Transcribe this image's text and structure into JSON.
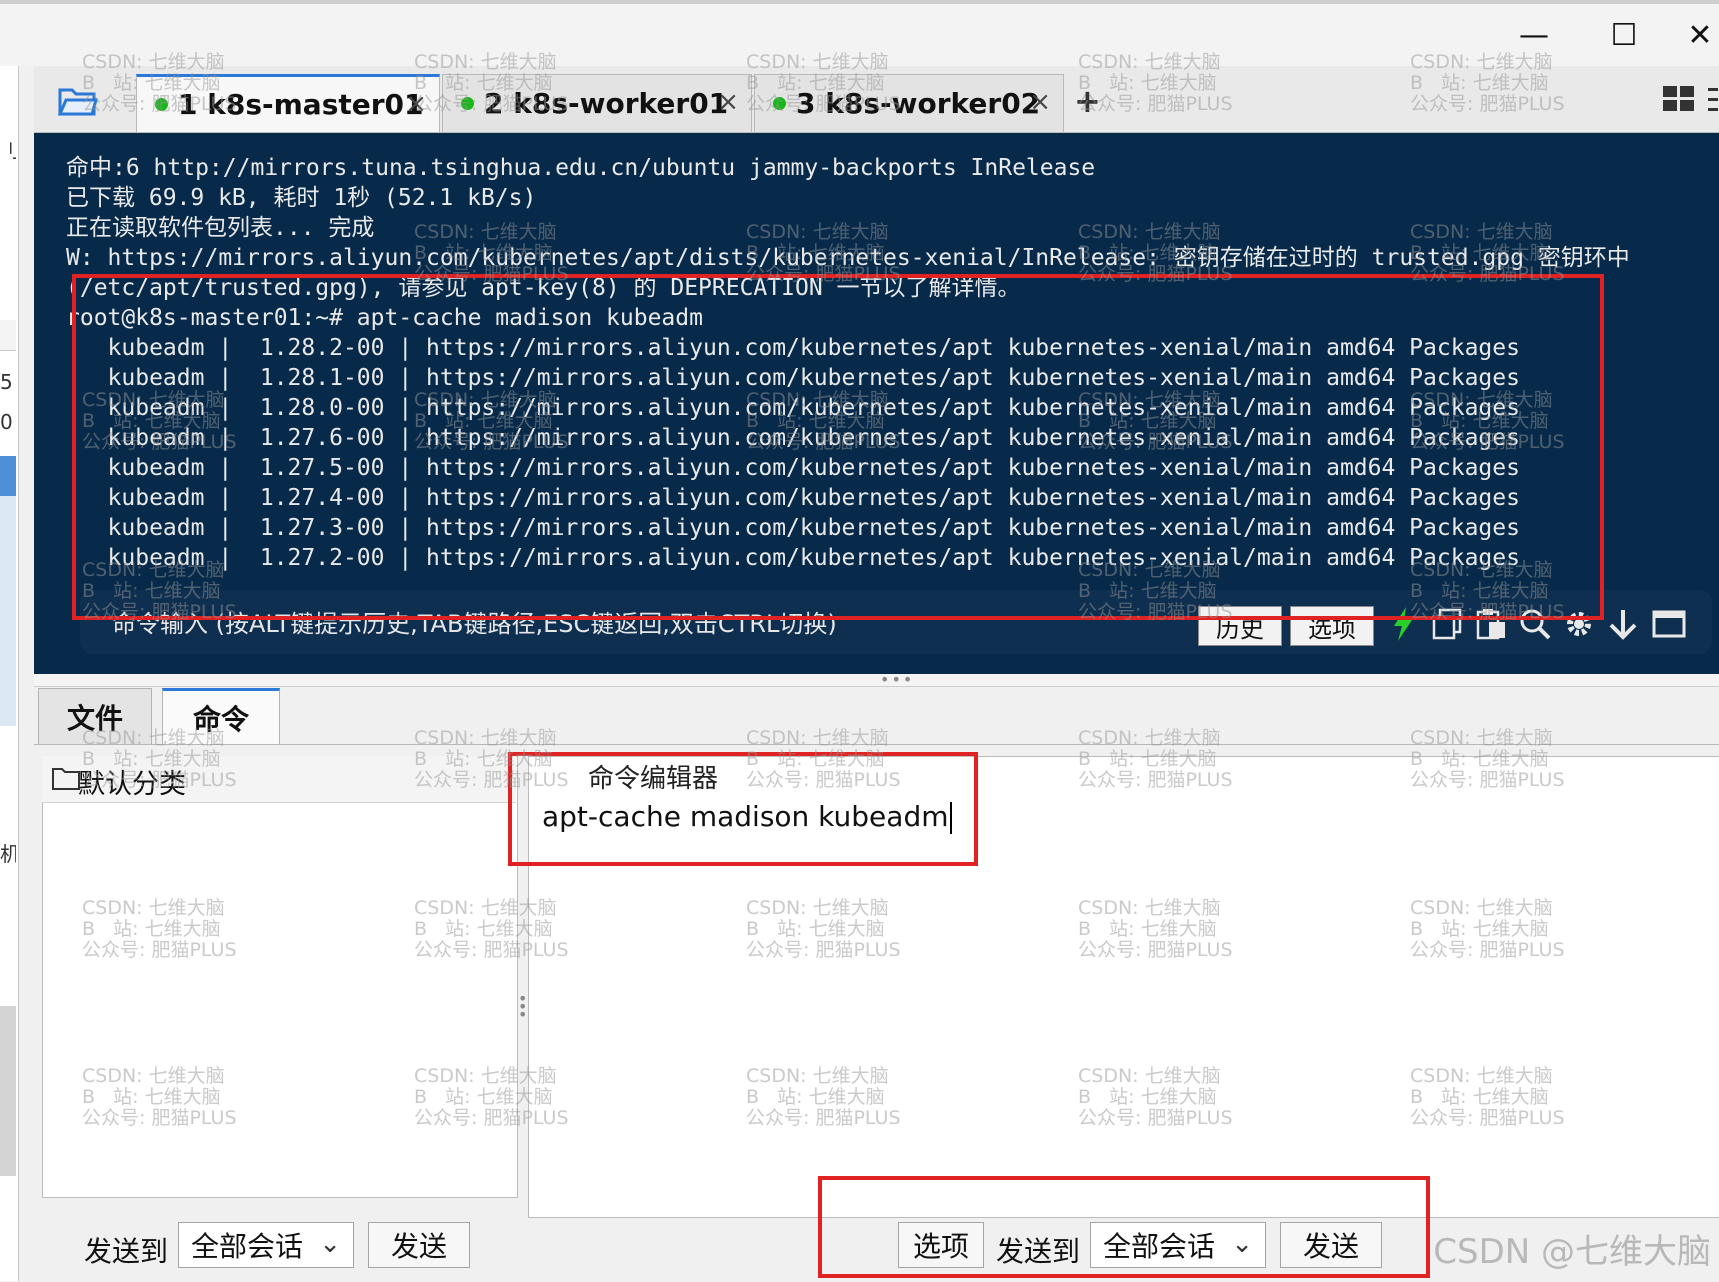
{
  "window": {
    "minimize": "—",
    "maximize": "☐",
    "close": "✕"
  },
  "sidebar": {
    "fragments": [
      "刂",
      "5",
      "0",
      "机"
    ]
  },
  "tabs": [
    {
      "label": "1 k8s-master01",
      "status": "connected",
      "active": true
    },
    {
      "label": "2 k8s-worker01",
      "status": "connected",
      "active": false
    },
    {
      "label": "3 k8s-worker02",
      "status": "connected",
      "active": false
    }
  ],
  "tab_close": "×",
  "tab_add": "+",
  "icons": {
    "folder": "folder-icon",
    "grid": "grid-icon",
    "menu": "menu-icon",
    "lightning": "lightning-icon",
    "copy": "copy-icon",
    "paste": "paste-icon",
    "search": "search-icon",
    "settings": "gear-icon",
    "download": "arrow-down-icon",
    "window": "window-icon"
  },
  "colors": {
    "terminal_bg": "#072a4a",
    "tab_status": "#18b818",
    "annotation": "#e02222",
    "accent": "#2a78d7"
  },
  "terminal": {
    "lines": [
      "命中:6 http://mirrors.tuna.tsinghua.edu.cn/ubuntu jammy-backports InRelease",
      "已下载 69.9 kB, 耗时 1秒 (52.1 kB/s)",
      "正在读取软件包列表... 完成",
      "W: https://mirrors.aliyun.com/kubernetes/apt/dists/kubernetes-xenial/InRelease: 密钥存储在过时的 trusted.gpg 密钥环中",
      "(/etc/apt/trusted.gpg), 请参见 apt-key(8) 的 DEPRECATION 一节以了解详情。",
      "root@k8s-master01:~# apt-cache madison kubeadm",
      "   kubeadm |  1.28.2-00 | https://mirrors.aliyun.com/kubernetes/apt kubernetes-xenial/main amd64 Packages",
      "   kubeadm |  1.28.1-00 | https://mirrors.aliyun.com/kubernetes/apt kubernetes-xenial/main amd64 Packages",
      "   kubeadm |  1.28.0-00 | https://mirrors.aliyun.com/kubernetes/apt kubernetes-xenial/main amd64 Packages",
      "   kubeadm |  1.27.6-00 | https://mirrors.aliyun.com/kubernetes/apt kubernetes-xenial/main amd64 Packages",
      "   kubeadm |  1.27.5-00 | https://mirrors.aliyun.com/kubernetes/apt kubernetes-xenial/main amd64 Packages",
      "   kubeadm |  1.27.4-00 | https://mirrors.aliyun.com/kubernetes/apt kubernetes-xenial/main amd64 Packages",
      "   kubeadm |  1.27.3-00 | https://mirrors.aliyun.com/kubernetes/apt kubernetes-xenial/main amd64 Packages",
      "   kubeadm |  1.27.2-00 | https://mirrors.aliyun.com/kubernetes/apt kubernetes-xenial/main amd64 Packages"
    ],
    "input_hint": "命令输入 (按ALT键提示历史,TAB键路径,ESC键返回,双击CTRL切换)",
    "history_button": "历史",
    "options_button": "选项"
  },
  "bottom_tabs": [
    {
      "label": "文件",
      "active": false
    },
    {
      "label": "命令",
      "active": true
    }
  ],
  "commands_panel": {
    "category": "默认分类",
    "send_to_label": "发送到",
    "target": "全部会话",
    "send_button": "发送"
  },
  "editor": {
    "label": "命令编辑器",
    "text": "apt-cache madison kubeadm",
    "options_button": "选项",
    "send_to_label": "发送到",
    "target": "全部会话",
    "send_button": "发送"
  },
  "watermark": {
    "text": "CSDN: 七维大脑\nB   站: 七维大脑\n公众号: 肥猫PLUS",
    "corner": "CSDN @七维大脑"
  }
}
